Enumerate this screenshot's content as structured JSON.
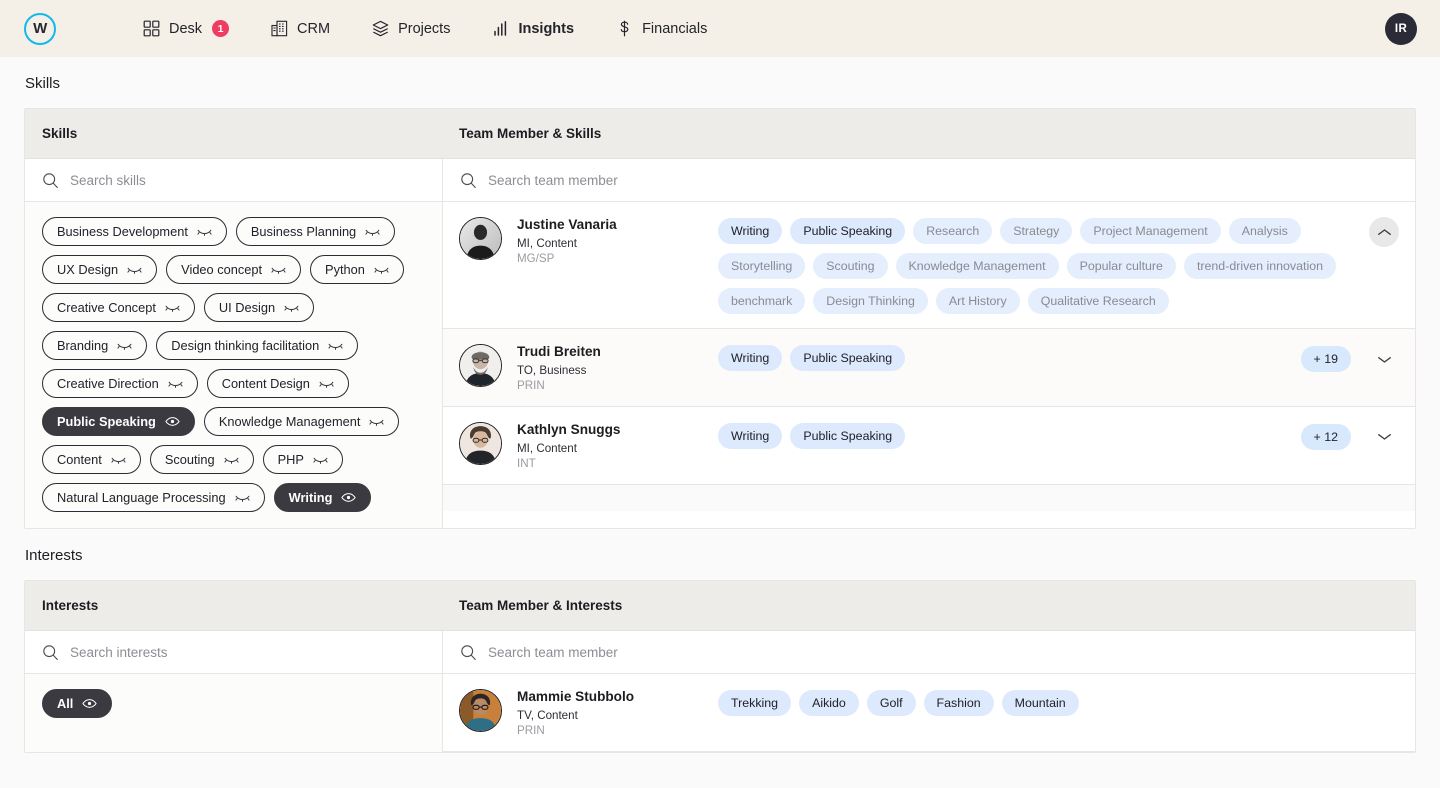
{
  "brand": {
    "logo_letter": "W",
    "accent": "#12b9ec"
  },
  "nav": {
    "items": [
      {
        "label": "Desk",
        "icon": "grid-icon",
        "badge": "1",
        "active": false
      },
      {
        "label": "CRM",
        "icon": "building-icon",
        "badge": "",
        "active": false
      },
      {
        "label": "Projects",
        "icon": "layers-icon",
        "badge": "",
        "active": false
      },
      {
        "label": "Insights",
        "icon": "bar-chart-icon",
        "badge": "",
        "active": true
      },
      {
        "label": "Financials",
        "icon": "dollar-icon",
        "badge": "",
        "active": false
      }
    ],
    "user_initials": "IR"
  },
  "skills_section": {
    "title": "Skills",
    "col_left_header": "Skills",
    "col_right_header": "Team Member & Skills",
    "search_skills_placeholder": "Search skills",
    "search_member_placeholder": "Search team member",
    "chips": [
      {
        "label": "Business Development",
        "selected": false
      },
      {
        "label": "Business Planning",
        "selected": false
      },
      {
        "label": "UX Design",
        "selected": false
      },
      {
        "label": "Video concept",
        "selected": false
      },
      {
        "label": "Python",
        "selected": false
      },
      {
        "label": "Creative Concept",
        "selected": false
      },
      {
        "label": "UI Design",
        "selected": false
      },
      {
        "label": "Branding",
        "selected": false
      },
      {
        "label": "Design thinking facilitation",
        "selected": false
      },
      {
        "label": "Creative Direction",
        "selected": false
      },
      {
        "label": "Content Design",
        "selected": false
      },
      {
        "label": "Public Speaking",
        "selected": true
      },
      {
        "label": "Knowledge Management",
        "selected": false
      },
      {
        "label": "Content",
        "selected": false
      },
      {
        "label": "Scouting",
        "selected": false
      },
      {
        "label": "PHP",
        "selected": false
      },
      {
        "label": "Natural Language Processing",
        "selected": false
      },
      {
        "label": "Writing",
        "selected": true
      }
    ],
    "members": [
      {
        "name": "Justine Vanaria",
        "role": "MI, Content",
        "level": "MG/SP",
        "expanded": true,
        "matched_tags": [
          "Writing",
          "Public Speaking"
        ],
        "other_tags": [
          "Research",
          "Strategy",
          "Project Management",
          "Analysis",
          "Storytelling",
          "Scouting",
          "Knowledge Management",
          "Popular culture",
          "trend-driven innovation",
          "benchmark",
          "Design Thinking",
          "Art History",
          "Qualitative Research"
        ],
        "more_count": "",
        "toggle_icon": "chevron-up-icon"
      },
      {
        "name": "Trudi Breiten",
        "role": "TO, Business",
        "level": "PRIN",
        "expanded": false,
        "matched_tags": [
          "Writing",
          "Public Speaking"
        ],
        "other_tags": [],
        "more_count": "+ 19",
        "toggle_icon": "chevron-down-icon"
      },
      {
        "name": "Kathlyn Snuggs",
        "role": "MI, Content",
        "level": "INT",
        "expanded": false,
        "matched_tags": [
          "Writing",
          "Public Speaking"
        ],
        "other_tags": [],
        "more_count": "+ 12",
        "toggle_icon": "chevron-down-icon"
      }
    ]
  },
  "interests_section": {
    "title": "Interests",
    "col_left_header": "Interests",
    "col_right_header": "Team Member & Interests",
    "search_interests_placeholder": "Search interests",
    "search_member_placeholder": "Search team member",
    "chips": [
      {
        "label": "All",
        "selected": true
      }
    ],
    "members": [
      {
        "name": "Mammie Stubbolo",
        "role": "TV, Content",
        "level": "PRIN",
        "matched_tags": [
          "Trekking",
          "Aikido",
          "Golf",
          "Fashion",
          "Mountain"
        ]
      }
    ]
  }
}
